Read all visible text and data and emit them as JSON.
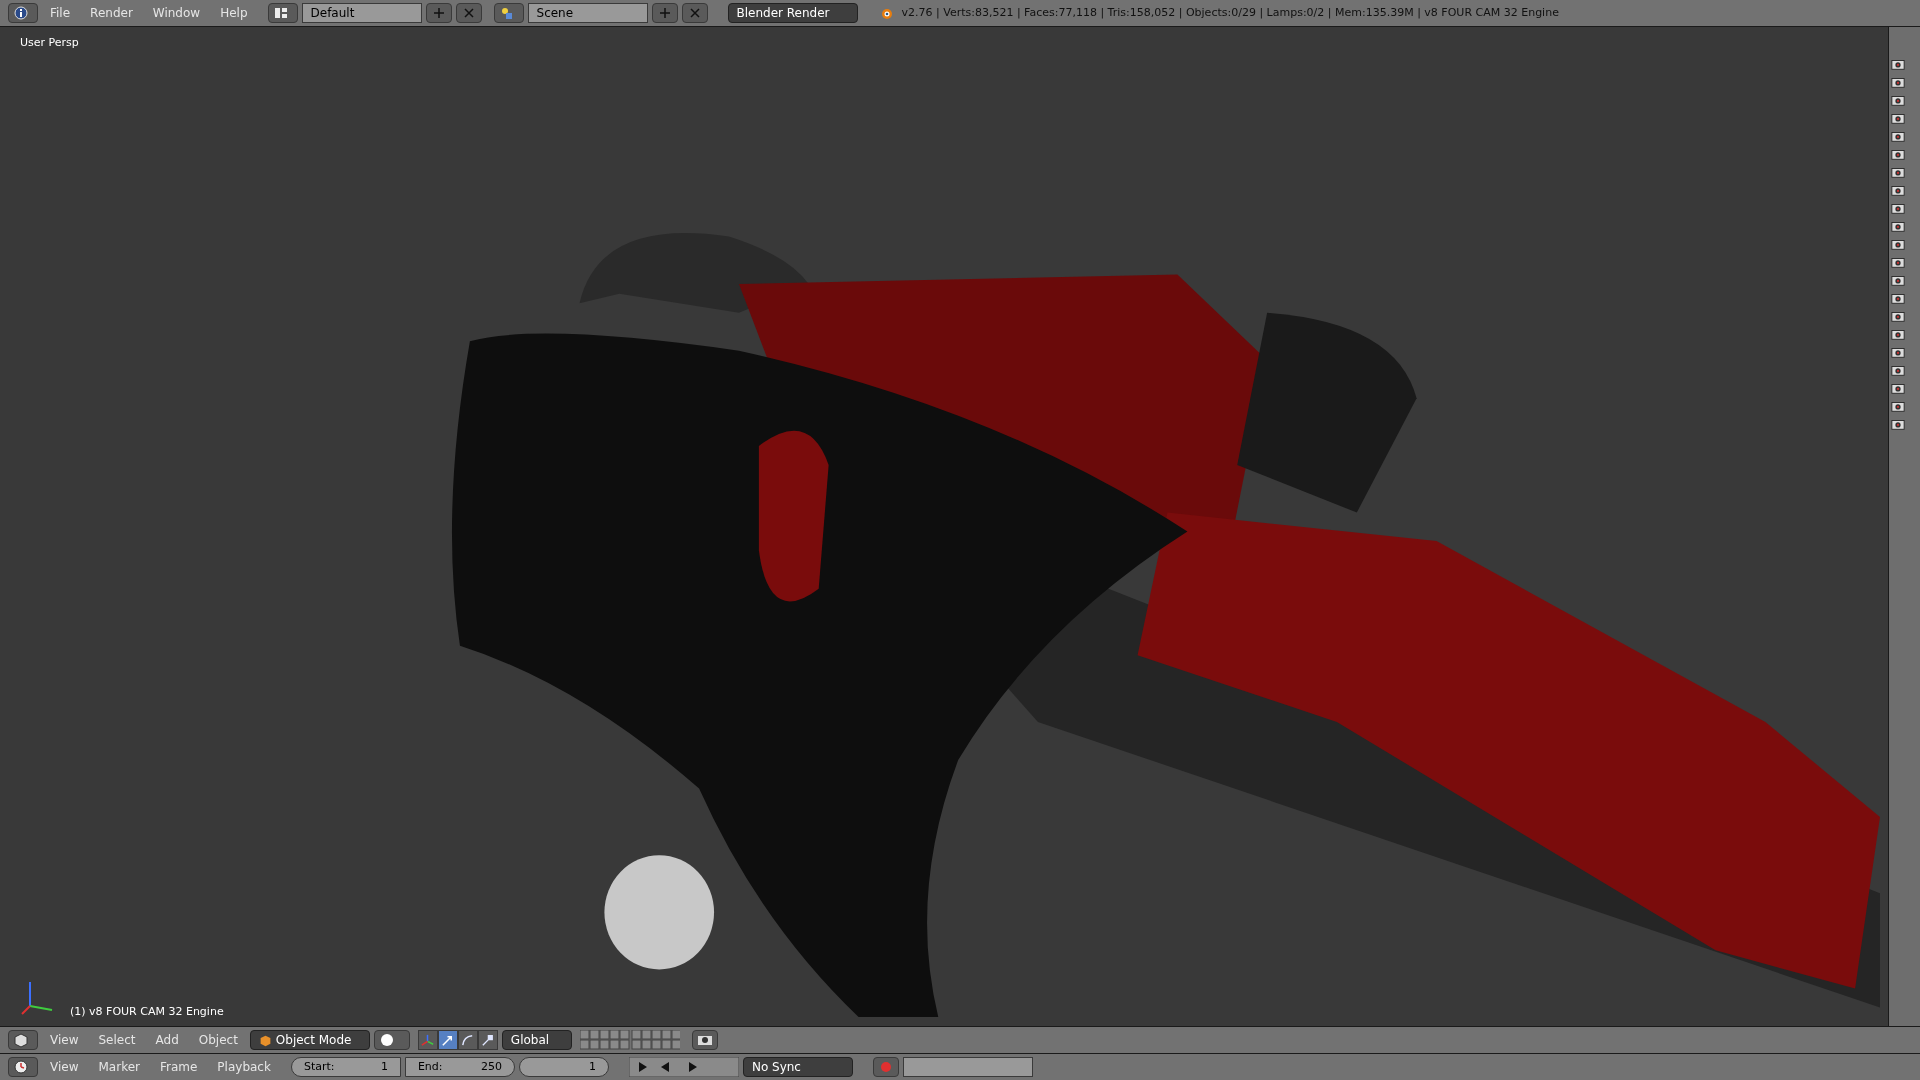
{
  "top_bar": {
    "menus": [
      "File",
      "Render",
      "Window",
      "Help"
    ],
    "layout": "Default",
    "scene": "Scene",
    "engine": "Blender Render",
    "stats": "v2.76 | Verts:83,521 | Faces:77,118 | Tris:158,052 | Objects:0/29 | Lamps:0/2 | Mem:135.39M | v8 FOUR CAM 32 Engine"
  },
  "viewport": {
    "view_label": "User Persp",
    "object_label": "(1) v8 FOUR CAM 32 Engine"
  },
  "view3d_header": {
    "menus": [
      "View",
      "Select",
      "Add",
      "Object"
    ],
    "mode": "Object Mode",
    "orientation": "Global",
    "manipulators": [
      {
        "kind": "axes",
        "selected": false
      },
      {
        "kind": "translate",
        "selected": true
      },
      {
        "kind": "rotate",
        "selected": false
      },
      {
        "kind": "scale",
        "selected": false
      }
    ]
  },
  "timeline_header": {
    "menus": [
      "View",
      "Marker",
      "Frame",
      "Playback"
    ],
    "start_label": "Start:",
    "start": "1",
    "end_label": "End:",
    "end": "250",
    "current": "1",
    "sync": "No Sync"
  }
}
